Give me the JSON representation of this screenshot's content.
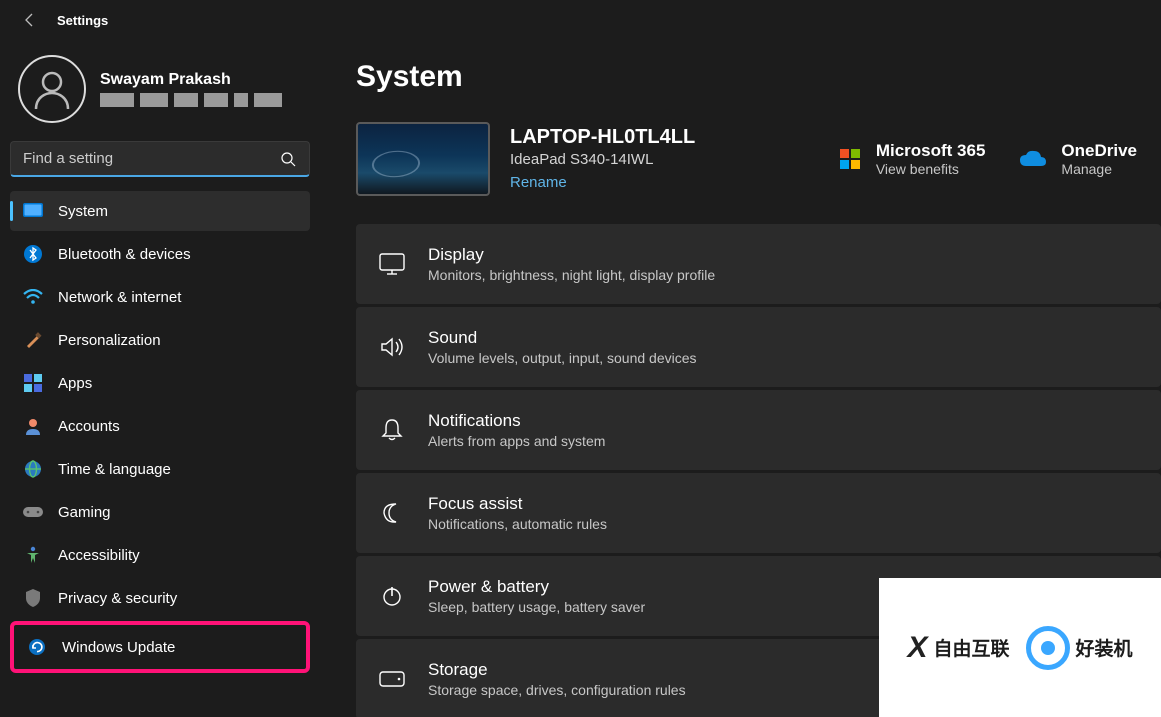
{
  "app": {
    "title": "Settings"
  },
  "profile": {
    "name": "Swayam Prakash"
  },
  "search": {
    "placeholder": "Find a setting"
  },
  "sidebar": {
    "items": [
      {
        "label": "System",
        "icon": "system-icon",
        "active": true
      },
      {
        "label": "Bluetooth & devices",
        "icon": "bluetooth-icon"
      },
      {
        "label": "Network & internet",
        "icon": "wifi-icon"
      },
      {
        "label": "Personalization",
        "icon": "brush-icon"
      },
      {
        "label": "Apps",
        "icon": "apps-icon"
      },
      {
        "label": "Accounts",
        "icon": "person-icon"
      },
      {
        "label": "Time & language",
        "icon": "globe-icon"
      },
      {
        "label": "Gaming",
        "icon": "gamepad-icon"
      },
      {
        "label": "Accessibility",
        "icon": "accessibility-icon"
      },
      {
        "label": "Privacy & security",
        "icon": "shield-icon"
      },
      {
        "label": "Windows Update",
        "icon": "update-icon",
        "highlighted": true
      }
    ]
  },
  "main": {
    "title": "System",
    "device": {
      "name": "LAPTOP-HL0TL4LL",
      "model": "IdeaPad S340-14IWL",
      "rename": "Rename"
    },
    "cloud": [
      {
        "name": "Microsoft 365",
        "sub": "View benefits",
        "icon": "ms365-icon"
      },
      {
        "name": "OneDrive",
        "sub": "Manage",
        "icon": "onedrive-icon"
      }
    ],
    "settings": [
      {
        "title": "Display",
        "sub": "Monitors, brightness, night light, display profile",
        "icon": "display-icon"
      },
      {
        "title": "Sound",
        "sub": "Volume levels, output, input, sound devices",
        "icon": "sound-icon"
      },
      {
        "title": "Notifications",
        "sub": "Alerts from apps and system",
        "icon": "bell-icon"
      },
      {
        "title": "Focus assist",
        "sub": "Notifications, automatic rules",
        "icon": "moon-icon"
      },
      {
        "title": "Power & battery",
        "sub": "Sleep, battery usage, battery saver",
        "icon": "power-icon"
      },
      {
        "title": "Storage",
        "sub": "Storage space, drives, configuration rules",
        "icon": "drive-icon"
      }
    ]
  },
  "watermark": {
    "left": "自由互联",
    "right": "好装机"
  }
}
